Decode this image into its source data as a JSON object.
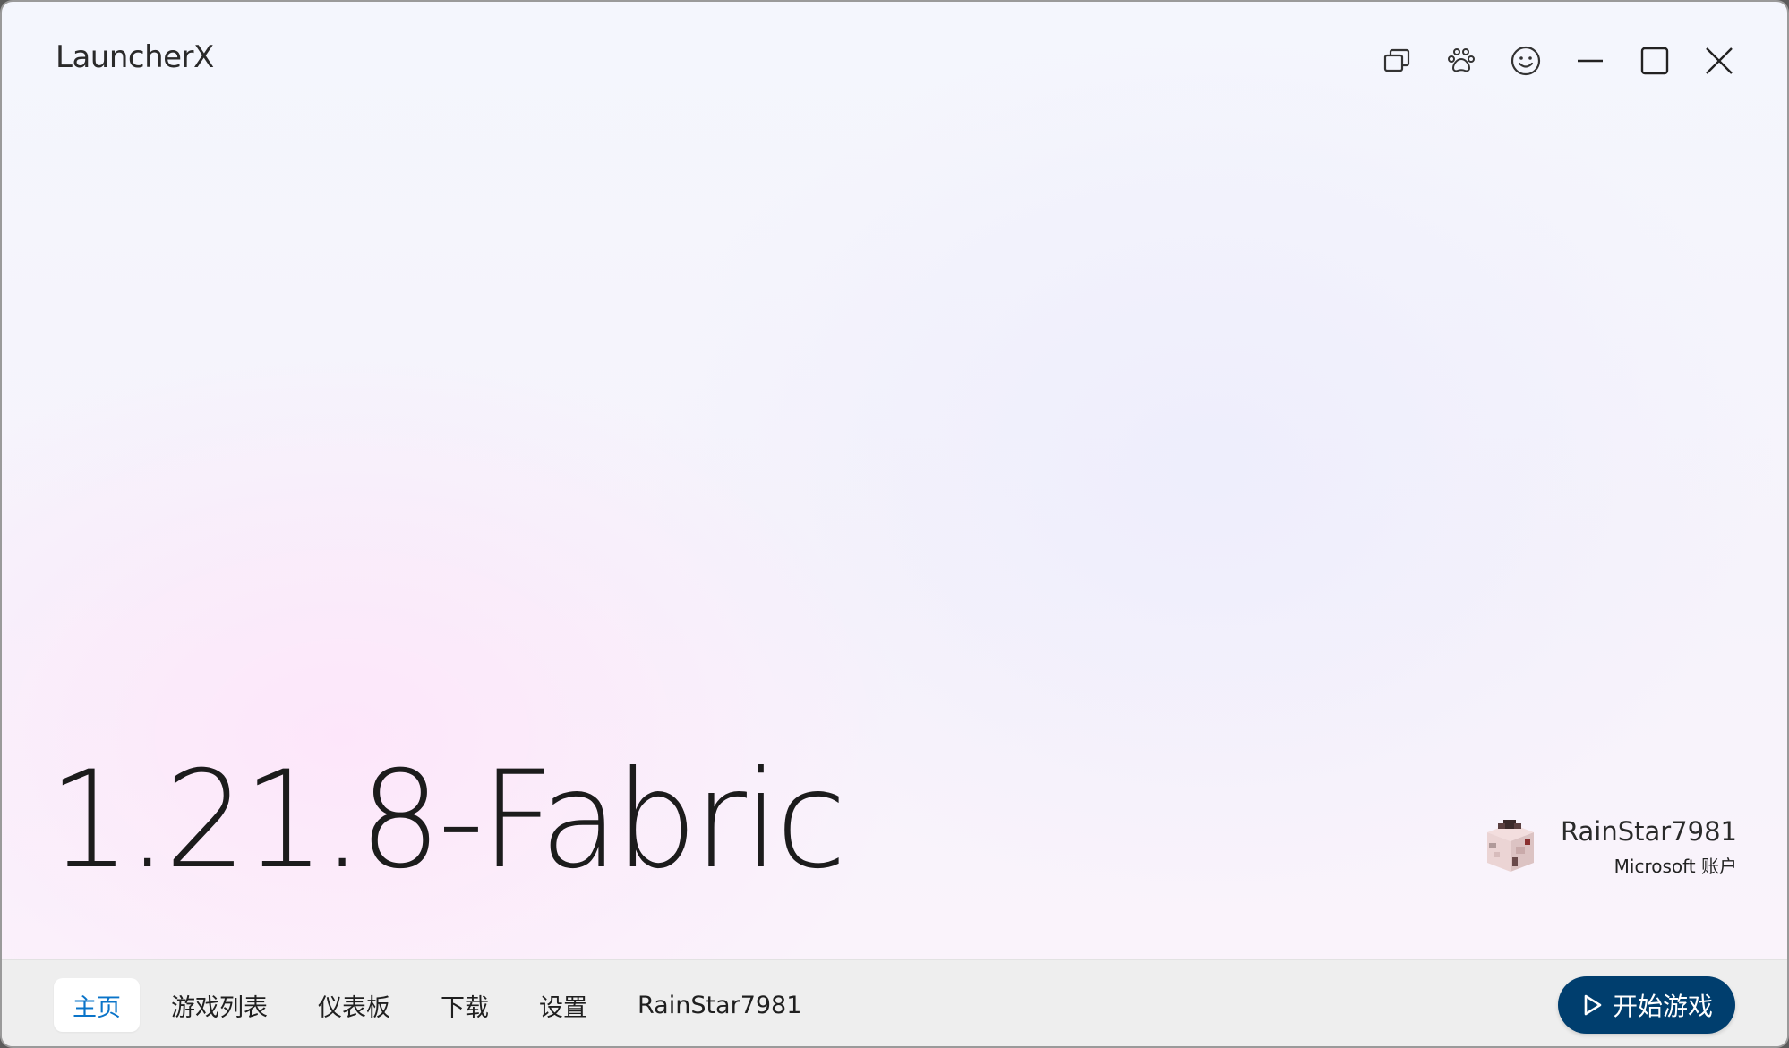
{
  "app": {
    "title": "LauncherX"
  },
  "title_actions": [
    {
      "name": "multi-window-icon"
    },
    {
      "name": "paw-icon"
    },
    {
      "name": "smiley-icon"
    },
    {
      "name": "minimize-icon"
    },
    {
      "name": "maximize-icon"
    },
    {
      "name": "close-icon"
    }
  ],
  "hero": {
    "version": "1.21.8-Fabric"
  },
  "account": {
    "name": "RainStar7981",
    "type": "Microsoft 账户",
    "avatar_icon": "player-skin-avatar"
  },
  "nav": {
    "items": [
      {
        "label": "主页",
        "active": true
      },
      {
        "label": "游戏列表",
        "active": false
      },
      {
        "label": "仪表板",
        "active": false
      },
      {
        "label": "下载",
        "active": false
      },
      {
        "label": "设置",
        "active": false
      },
      {
        "label": "RainStar7981",
        "active": false
      }
    ]
  },
  "play_button": {
    "label": "开始游戏",
    "icon": "play-icon"
  },
  "colors": {
    "accent": "#0a74c9",
    "play_button_bg": "#003e6e",
    "bottom_bar_bg": "#eeeeee"
  }
}
